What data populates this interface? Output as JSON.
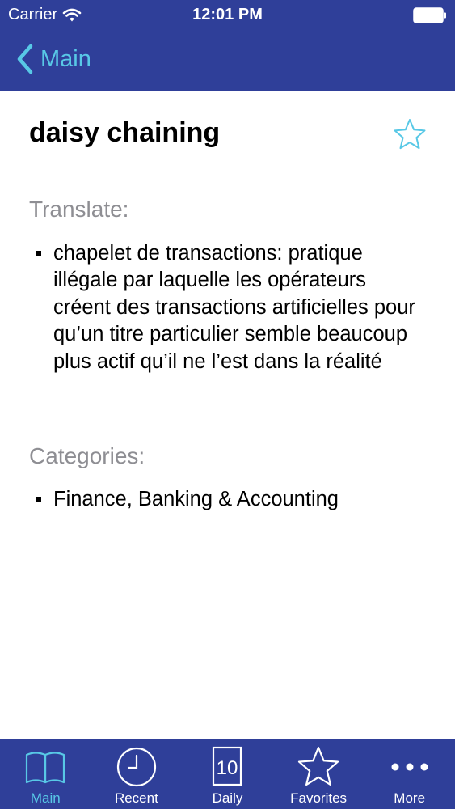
{
  "status_bar": {
    "carrier": "Carrier",
    "time": "12:01 PM"
  },
  "nav": {
    "back_label": "Main"
  },
  "entry": {
    "term": "daisy chaining",
    "translate_heading": "Translate:",
    "translations": [
      "chapelet de transactions: pratique illégale par laquelle les opérateurs créent des transactions artificielles pour qu’un titre particulier semble beaucoup plus actif qu’il ne l’est dans la réalité"
    ],
    "categories_heading": "Categories:",
    "categories": [
      "Finance, Banking & Accounting"
    ]
  },
  "tab_bar": {
    "tabs": [
      {
        "label": "Main",
        "icon": "book-icon",
        "active": true
      },
      {
        "label": "Recent",
        "icon": "clock-icon",
        "active": false
      },
      {
        "label": "Daily",
        "icon": "calendar-icon",
        "badge": "10",
        "active": false
      },
      {
        "label": "Favorites",
        "icon": "star-icon",
        "active": false
      },
      {
        "label": "More",
        "icon": "more-icon",
        "active": false
      }
    ]
  },
  "colors": {
    "bar_background": "#2f3f99",
    "accent": "#58c8e6",
    "heading_gray": "#8e8e93"
  }
}
